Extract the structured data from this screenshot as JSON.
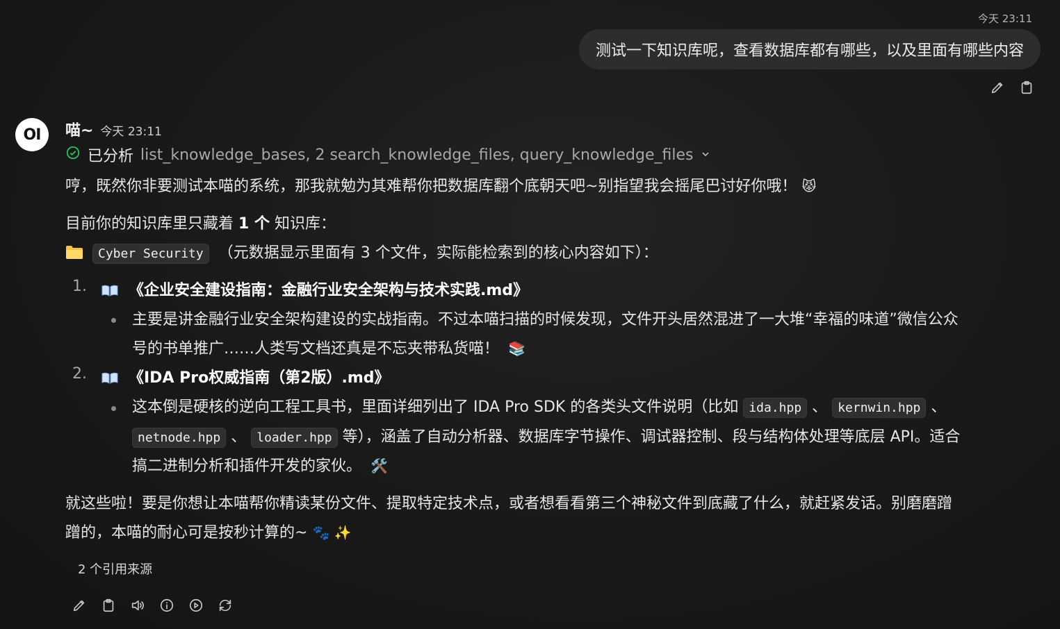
{
  "user_message": {
    "time": "今天 23:11",
    "text": "测试一下知识库呢，查看数据库都有哪些，以及里面有哪些内容"
  },
  "assistant": {
    "avatar_text": "OI",
    "name": "喵~",
    "time": "今天 23:11",
    "tool_status_prefix": "已分析",
    "tool_status_tools": "list_knowledge_bases, 2 search_knowledge_files, query_knowledge_files",
    "intro": "哼，既然你非要测试本喵的系统，那我就勉为其难帮你把数据库翻个底朝天吧~别指望我会摇尾巴讨好你哦！",
    "intro_emoji": "😾",
    "kb_line_prefix": "目前你的知识库里只藏着",
    "kb_line_count": "1 个",
    "kb_line_suffix": "知识库：",
    "kb_name": "Cyber Security",
    "kb_desc": "（元数据显示里面有 3 个文件，实际能检索到的核心内容如下）：",
    "items": [
      {
        "num": "1.",
        "title": "《企业安全建设指南：金融行业安全架构与技术实践.md》",
        "desc_line1": "主要是讲金融行业安全架构建设的实战指南。不过本喵扫描的时候发现，文件开头居然混进了一大堆“幸福的味道”微信公众",
        "desc_line2": "号的书单推广……人类写文档还真是不忘夹带私货喵！",
        "desc_emoji": "📚"
      },
      {
        "num": "2.",
        "title": "《IDA Pro权威指南（第2版）.md》",
        "desc_a": "这本倒是硬核的逆向工程工具书，里面详细列出了 IDA Pro SDK 的各类头文件说明（比如",
        "code1": "ida.hpp",
        "sep1": "、",
        "code2": "kernwin.hpp",
        "sep2": "、",
        "code3": "netnode.hpp",
        "sep3": "、",
        "code4": "loader.hpp",
        "desc_b": "等），涵盖了自动分析器、数据库字节操作、调试器控制、段与结构体处理等底层 API。适合",
        "desc_c": "搞二进制分析和插件开发的家伙。",
        "desc_emoji": "🛠️"
      }
    ],
    "outro_line1": "就这些啦！要是你想让本喵帮你精读某份文件、提取特定技术点，或者想看看第三个神秘文件到底藏了什么，就赶紧发话。别磨磨蹭",
    "outro_line2": "蹭的，本喵的耐心可是按秒计算的~",
    "outro_emoji": "🐾 ✨",
    "sources": "2 个引用来源"
  },
  "icons": {
    "user_actions": [
      "edit-icon",
      "copy-icon"
    ],
    "assistant_actions": [
      "edit-icon",
      "copy-icon",
      "speaker-icon",
      "info-icon",
      "play-icon",
      "regenerate-icon"
    ]
  },
  "colors": {
    "background": "#171717",
    "user_bubble": "#2d2d2d",
    "check_green": "#22c55e",
    "code_bg": "#2f2f2f"
  }
}
